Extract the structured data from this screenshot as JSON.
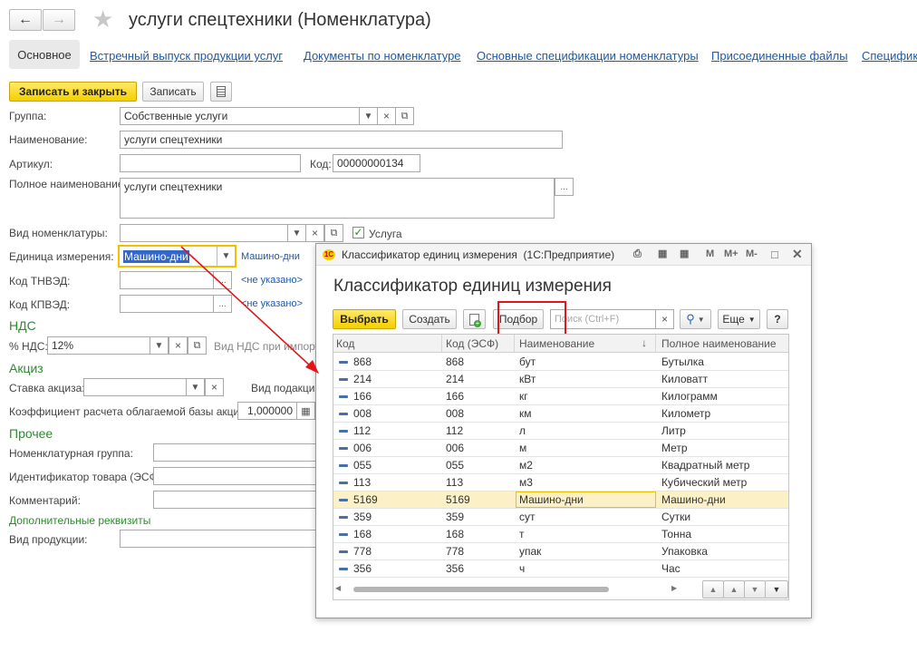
{
  "window": {
    "title": "услуги спецтехники (Номенклатура)"
  },
  "tabs": [
    {
      "label": "Основное"
    },
    {
      "label": "Встречный выпуск продукции услуг"
    },
    {
      "label": "Документы по номенклатуре"
    },
    {
      "label": "Основные спецификации номенклатуры"
    },
    {
      "label": "Присоединенные файлы"
    },
    {
      "label": "Специфика"
    }
  ],
  "toolbar": {
    "save_close": "Записать и закрыть",
    "save": "Записать"
  },
  "form": {
    "group_label": "Группа:",
    "group_value": "Собственные услуги",
    "name_label": "Наименование:",
    "name_value": "услуги спецтехники",
    "article_label": "Артикул:",
    "article_value": "",
    "code_label": "Код:",
    "code_value": "00000000134",
    "fullname_label": "Полное наименование:",
    "fullname_value": "услуги спецтехники",
    "kind_label": "Вид номенклатуры:",
    "kind_value": "",
    "service_label": "Услуга",
    "unit_label": "Единица измерения:",
    "unit_value": "Машино-дни",
    "unit_link": "Машино-дни",
    "tnved_label": "Код ТНВЭД:",
    "tnved_link": "<не указано>",
    "kpved_label": "Код КПВЭД:",
    "kpved_link": "<не указано>",
    "vat_section": "НДС",
    "vat_label": "% НДС:",
    "vat_value": "12%",
    "vat_kind_label": "Вид НДС при импорте:",
    "excise_section": "Акциз",
    "excise_rate_label": "Ставка акциза:",
    "excise_kind_label": "Вид подакцизного",
    "coef_label": "Коэффициент расчета облагаемой базы акциза:",
    "coef_value": "1,000000",
    "other_section": "Прочее",
    "nomgroup_label": "Номенклатурная группа:",
    "goodsid_label": "Идентификатор товара (ЭСФ):",
    "comment_label": "Комментарий:",
    "addreq_link": "Дополнительные реквизиты",
    "prodkind_label": "Вид продукции:"
  },
  "dialog": {
    "titlebar": "Классификатор единиц измерения  (1С:Предприятие)",
    "heading": "Классификатор единиц измерения",
    "select_btn": "Выбрать",
    "create_btn": "Создать",
    "pick_btn": "Подбор",
    "search_placeholder": "Поиск (Ctrl+F)",
    "more_btn": "Еще",
    "help_btn": "?",
    "columns": [
      "Код",
      "Код (ЭСФ)",
      "Наименование",
      "Полное наименование"
    ],
    "rows": [
      {
        "code": "868",
        "esf": "868",
        "name": "бут",
        "full": "Бутылка"
      },
      {
        "code": "214",
        "esf": "214",
        "name": "кВт",
        "full": "Киловатт"
      },
      {
        "code": "166",
        "esf": "166",
        "name": "кг",
        "full": "Килограмм"
      },
      {
        "code": "008",
        "esf": "008",
        "name": "км",
        "full": "Километр"
      },
      {
        "code": "112",
        "esf": "112",
        "name": "л",
        "full": "Литр"
      },
      {
        "code": "006",
        "esf": "006",
        "name": "м",
        "full": "Метр"
      },
      {
        "code": "055",
        "esf": "055",
        "name": "м2",
        "full": "Квадратный метр"
      },
      {
        "code": "113",
        "esf": "113",
        "name": "м3",
        "full": "Кубический метр"
      },
      {
        "code": "5169",
        "esf": "5169",
        "name": "Машино-дни",
        "full": "Машино-дни"
      },
      {
        "code": "359",
        "esf": "359",
        "name": "сут",
        "full": "Сутки"
      },
      {
        "code": "168",
        "esf": "168",
        "name": "т",
        "full": "Тонна"
      },
      {
        "code": "778",
        "esf": "778",
        "name": "упак",
        "full": "Упаковка"
      },
      {
        "code": "356",
        "esf": "356",
        "name": "ч",
        "full": "Час"
      }
    ]
  },
  "colors": {
    "accent_yellow": "#f5cf00",
    "link": "#1d5aa8",
    "section": "#2e8b2e",
    "highlight": "#e0161a",
    "selected_row": "#fbf0c6"
  }
}
